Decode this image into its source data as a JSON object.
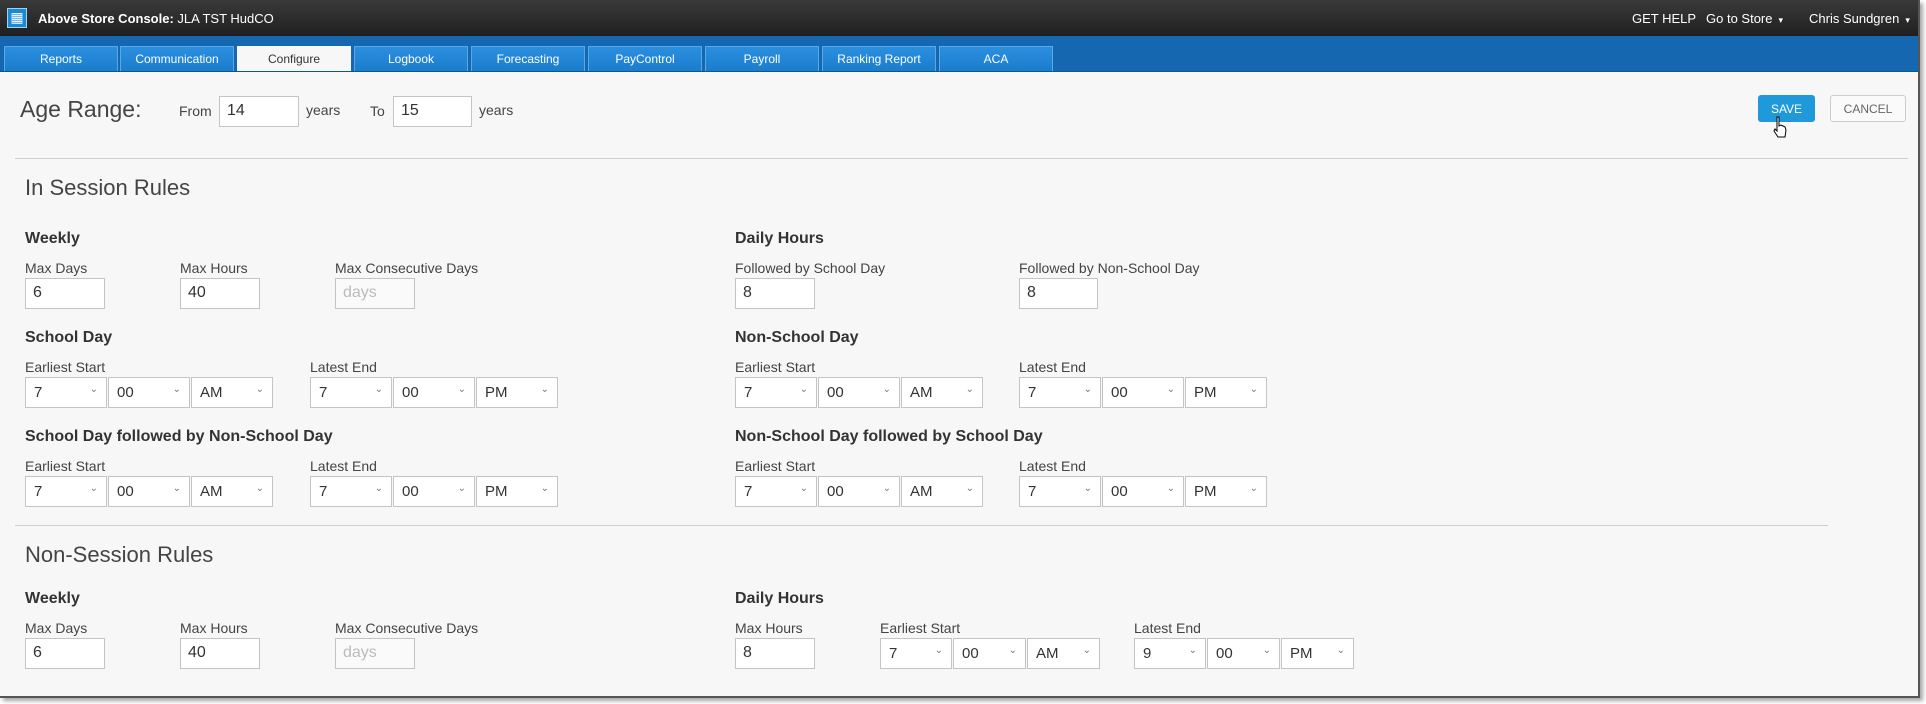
{
  "app": {
    "title_bold": "Above Store Console:",
    "title_store": "JLA TST HudCO",
    "logo_icon": "grid-logo-icon"
  },
  "topbar": {
    "help": "GET HELP",
    "store": "Go to Store",
    "user": "Chris Sundgren",
    "caret": "▾"
  },
  "tabs": [
    "Reports",
    "Communication",
    "Configure",
    "Logbook",
    "Forecasting",
    "PayControl",
    "Payroll",
    "Ranking Report",
    "ACA"
  ],
  "active_tab": "Configure",
  "age_range": {
    "title": "Age Range:",
    "from_label": "From",
    "from_value": "14",
    "years1": "years",
    "to_label": "To",
    "to_value": "15",
    "years2": "years"
  },
  "actions": {
    "save": "SAVE",
    "cancel": "CANCEL"
  },
  "in_session": {
    "title": "In Session Rules",
    "weekly": {
      "title": "Weekly",
      "max_days_label": "Max Days",
      "max_days": "6",
      "max_hours_label": "Max Hours",
      "max_hours": "40",
      "max_consec_label": "Max Consecutive Days",
      "max_consec_placeholder": "days"
    },
    "daily": {
      "title": "Daily Hours",
      "school_label": "Followed by School Day",
      "school": "8",
      "nonschool_label": "Followed by Non-School Day",
      "nonschool": "8"
    },
    "school_day": {
      "title": "School Day",
      "start_label": "Earliest Start",
      "start": [
        "7",
        "00",
        "AM"
      ],
      "end_label": "Latest End",
      "end": [
        "7",
        "00",
        "PM"
      ]
    },
    "non_school_day": {
      "title": "Non-School Day",
      "start_label": "Earliest Start",
      "start": [
        "7",
        "00",
        "AM"
      ],
      "end_label": "Latest End",
      "end": [
        "7",
        "00",
        "PM"
      ]
    },
    "school_then_non": {
      "title": "School Day followed by Non-School Day",
      "start_label": "Earliest Start",
      "start": [
        "7",
        "00",
        "AM"
      ],
      "end_label": "Latest End",
      "end": [
        "7",
        "00",
        "PM"
      ]
    },
    "non_then_school": {
      "title": "Non-School Day followed by School Day",
      "start_label": "Earliest Start",
      "start": [
        "7",
        "00",
        "AM"
      ],
      "end_label": "Latest End",
      "end": [
        "7",
        "00",
        "PM"
      ]
    }
  },
  "non_session": {
    "title": "Non-Session Rules",
    "weekly": {
      "title": "Weekly",
      "max_days_label": "Max Days",
      "max_days": "6",
      "max_hours_label": "Max Hours",
      "max_hours": "40",
      "max_consec_label": "Max Consecutive Days",
      "max_consec_placeholder": "days"
    },
    "daily": {
      "title": "Daily Hours",
      "max_hours_label": "Max Hours",
      "max_hours": "8",
      "start_label": "Earliest Start",
      "start": [
        "7",
        "00",
        "AM"
      ],
      "end_label": "Latest End",
      "end": [
        "9",
        "00",
        "PM"
      ]
    }
  },
  "chevron": "⌄"
}
